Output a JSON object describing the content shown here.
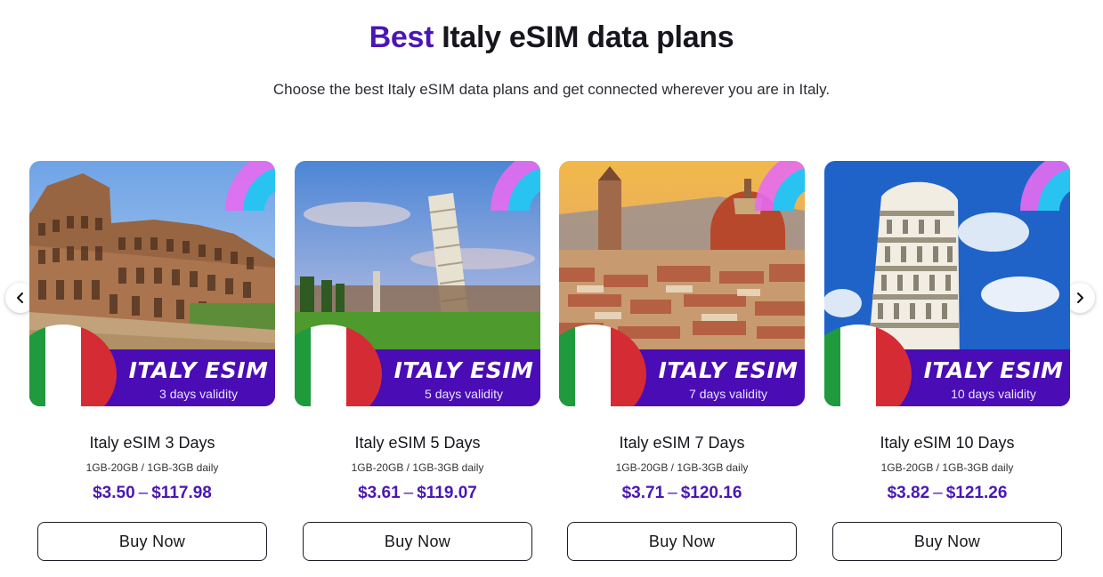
{
  "header": {
    "title_accent": "Best",
    "title_rest": "Italy eSIM data plans",
    "subtitle": "Choose the best Italy eSIM data plans and get connected wherever you are in Italy."
  },
  "carousel": {
    "prev_icon": "chevron-left-icon",
    "next_icon": "chevron-right-icon"
  },
  "colors": {
    "accent": "#4a17b5",
    "banner": "#4a0cb4",
    "flag_green": "#1f9a3d",
    "flag_white": "#ffffff",
    "flag_red": "#d52b35"
  },
  "plans": [
    {
      "image_banner_title": "ITALY ESIM",
      "image_banner_sub": "3 days validity",
      "name": "Italy eSIM 3 Days",
      "data": "1GB-20GB / 1GB-3GB daily",
      "price_min": "$3.50",
      "price_sep": "–",
      "price_max": "$117.98",
      "button": "Buy Now"
    },
    {
      "image_banner_title": "ITALY ESIM",
      "image_banner_sub": "5 days validity",
      "name": "Italy eSIM 5 Days",
      "data": "1GB-20GB / 1GB-3GB daily",
      "price_min": "$3.61",
      "price_sep": "–",
      "price_max": "$119.07",
      "button": "Buy Now"
    },
    {
      "image_banner_title": "ITALY ESIM",
      "image_banner_sub": "7 days validity",
      "name": "Italy eSIM 7 Days",
      "data": "1GB-20GB / 1GB-3GB daily",
      "price_min": "$3.71",
      "price_sep": "–",
      "price_max": "$120.16",
      "button": "Buy Now"
    },
    {
      "image_banner_title": "ITALY ESIM",
      "image_banner_sub": "10 days validity",
      "name": "Italy eSIM 10 Days",
      "data": "1GB-20GB / 1GB-3GB daily",
      "price_min": "$3.82",
      "price_sep": "–",
      "price_max": "$121.26",
      "button": "Buy Now"
    }
  ]
}
